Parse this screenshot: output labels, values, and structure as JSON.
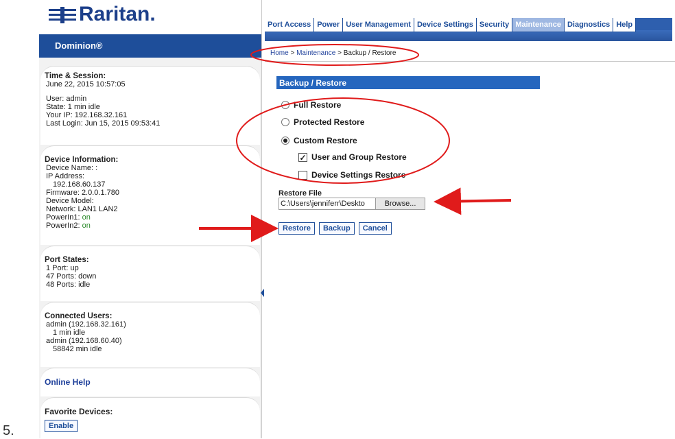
{
  "step_number": "5.",
  "logo": {
    "text": "Raritan."
  },
  "product_name": "Dominion®",
  "sidebar": {
    "time_session": {
      "heading": "Time & Session:",
      "date": "June 22, 2015 10:57:05",
      "user": "User: admin",
      "state": "State: 1 min idle",
      "ip": "Your IP: 192.168.32.161",
      "last_login": "Last Login: Jun 15, 2015 09:53:41"
    },
    "device_info": {
      "heading": "Device Information:",
      "device_name": "Device Name: :",
      "ip_label": "IP Address:",
      "ip_value": "192.168.60.137",
      "firmware": "Firmware: 2.0.0.1.780",
      "model": "Device Model:",
      "network": "Network: LAN1 LAN2",
      "power1_label": "PowerIn1: ",
      "power1_value": "on",
      "power2_label": "PowerIn2: ",
      "power2_value": "on"
    },
    "port_states": {
      "heading": "Port States:",
      "line1": "1 Port: up",
      "line2": "47 Ports: down",
      "line3": "48 Ports: idle"
    },
    "connected_users": {
      "heading": "Connected Users:",
      "u1": "admin (192.168.32.161)",
      "u1_idle": "1 min idle",
      "u2": "admin (192.168.60.40)",
      "u2_idle": "58842 min idle"
    },
    "online_help": "Online Help",
    "favorites": {
      "heading": "Favorite Devices:",
      "enable_label": "Enable"
    }
  },
  "nav": {
    "tabs": [
      {
        "label": "Port Access"
      },
      {
        "label": "Power"
      },
      {
        "label": "User Management"
      },
      {
        "label": "Device Settings"
      },
      {
        "label": "Security"
      },
      {
        "label": "Maintenance"
      },
      {
        "label": "Diagnostics"
      },
      {
        "label": "Help"
      }
    ],
    "active_tab": "Maintenance"
  },
  "breadcrumb": {
    "home": "Home",
    "sep": " > ",
    "maintenance": "Maintenance",
    "current": "Backup / Restore"
  },
  "section_title": "Backup / Restore",
  "restore_options": {
    "full": "Full Restore",
    "protected": "Protected Restore",
    "custom": "Custom Restore",
    "selected": "custom",
    "user_group": {
      "label": "User and Group Restore",
      "checked": true
    },
    "device_settings": {
      "label": "Device Settings Restore",
      "checked": false
    }
  },
  "restore_file": {
    "label": "Restore File",
    "value": "C:\\Users\\jenniferr\\Deskto",
    "browse_label": "Browse..."
  },
  "buttons": {
    "restore": "Restore",
    "backup": "Backup",
    "cancel": "Cancel"
  },
  "colors": {
    "brand_blue": "#1e4e9a",
    "header_blue": "#2566be",
    "annotation_red": "#e01b1b"
  }
}
